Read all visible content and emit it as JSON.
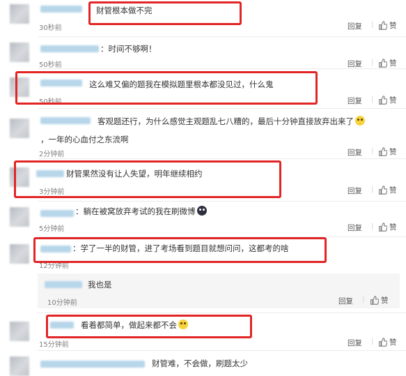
{
  "actions": {
    "reply_label": "回复",
    "like_label": "赞",
    "like_icon": "thumbs-up-icon",
    "separator": "|"
  },
  "colors": {
    "highlight": "#e22424",
    "username": "#b7d6ea",
    "time": "#808080"
  },
  "comments": [
    {
      "text": "财管根本做不完",
      "time": "30秒前"
    },
    {
      "text": "：时间不够啊！",
      "time": "50秒前"
    },
    {
      "text": "这么难又偏的题我在模拟题里根本都没见过，什么鬼",
      "time": "50秒前"
    },
    {
      "text": "客观题还行，为什么感觉主观题乱七八糟的，最后十分钟直接放弃出来了",
      "text2": "，一年的心血付之东流啊",
      "time": "2分钟前"
    },
    {
      "text": "财管果然没有让人失望，明年继续相约",
      "time": "3分钟前"
    },
    {
      "text": "：躺在被窝放弃考试的我在刷微博",
      "time": "5分钟前"
    },
    {
      "text": "：学了一半的财管，进了考场看到题目就想问问，这都考的啥",
      "time": "12分钟前"
    },
    {
      "text": "看着都简单，做起来都不会",
      "time": "15分钟前"
    },
    {
      "text": "财管难，不会做，刷题太少",
      "time": ""
    }
  ],
  "subreply": {
    "text": "我也是",
    "time": "10分钟前"
  }
}
